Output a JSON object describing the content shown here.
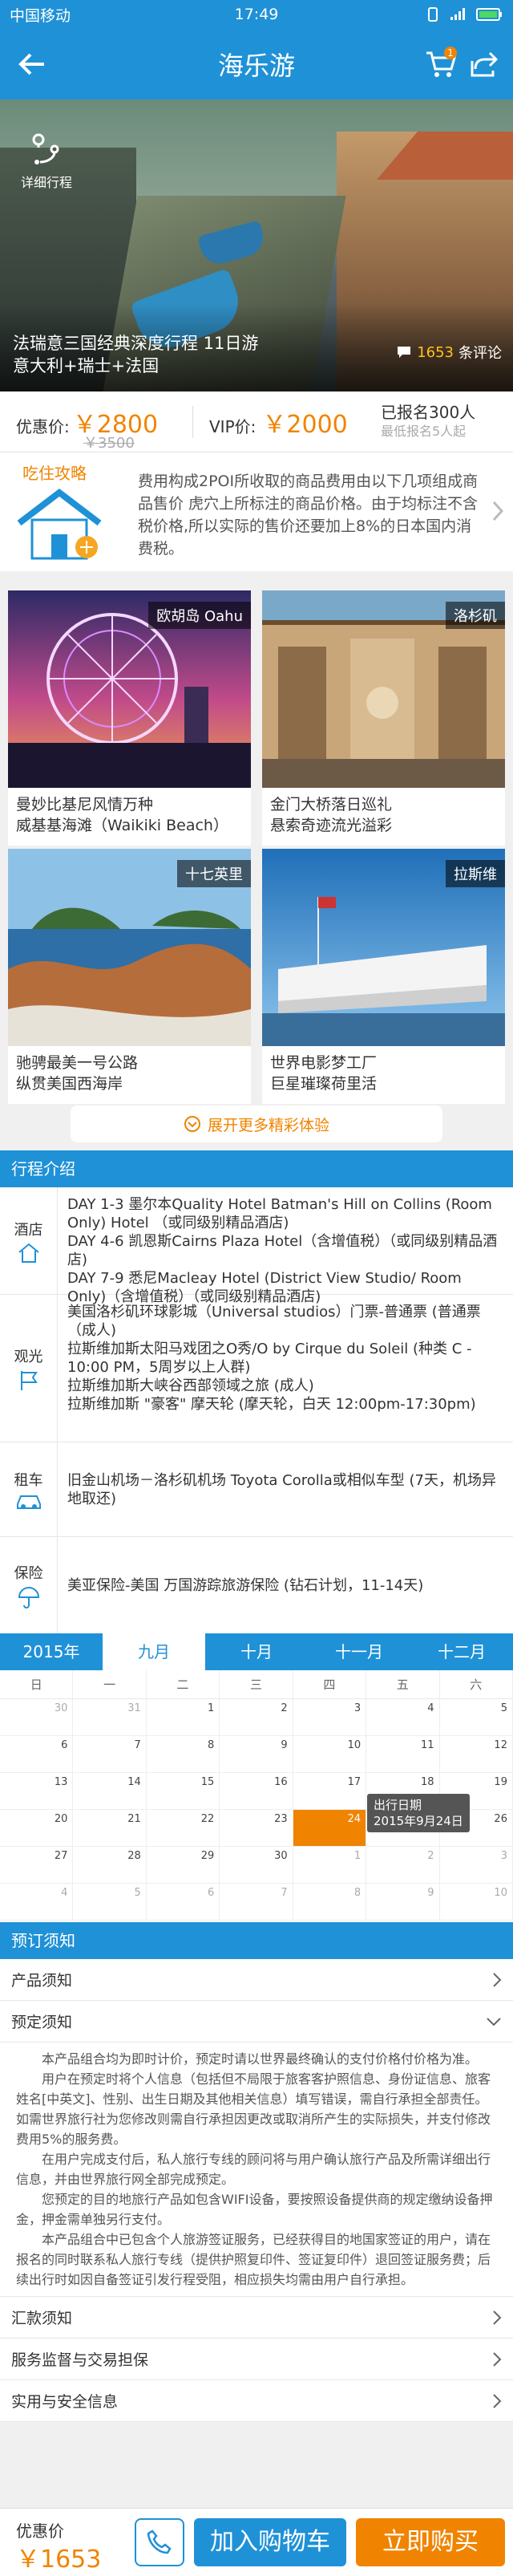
{
  "statusbar": {
    "carrier": "中国移动",
    "time": "17:49"
  },
  "nav": {
    "title": "海乐游",
    "cart_badge": "1"
  },
  "hero": {
    "detail_label": "详细行程",
    "name_line1": "法瑞意三国经典深度行程  11日游",
    "name_line2": "意大利+瑞士+法国",
    "review_count": "1653",
    "review_suffix": "条评论"
  },
  "price": {
    "label": "优惠价:",
    "value": "￥2800",
    "old": "￥3500",
    "vip_label": "VIP价:",
    "vip_value": "￥2000",
    "signed": "已报名300人",
    "min": "最低报名5人起"
  },
  "tips": {
    "title": "吃住攻略",
    "text": "费用构成2POI所收取的商品费用由以下几项组成商品售价 虎穴上所标注的商品价格。由于均标注不含税价格,所以实际的售价还要加上8%的日本国内消费税。"
  },
  "cards": [
    {
      "tag": "欧胡岛 Oahu",
      "cap1": "曼妙比基尼风情万种",
      "cap2": "威基基海滩（Waikiki Beach）"
    },
    {
      "tag": "洛杉矶",
      "cap1": "金门大桥落日巡礼",
      "cap2": "悬索奇迹流光溢彩"
    },
    {
      "tag": "十七英里",
      "cap1": "驰骋最美一号公路",
      "cap2": "纵贯美国西海岸"
    },
    {
      "tag": "拉斯维",
      "cap1": "世界电影梦工厂",
      "cap2": "巨星璀璨荷里活"
    }
  ],
  "more_label": "展开更多精彩体验",
  "itinerary": {
    "title": "行程介绍",
    "hotel_label": "酒店",
    "hotel_text": [
      "DAY 1-3 墨尔本Quality Hotel Batman's Hill on Collins (Room Only) Hotel （或同级别精品酒店)",
      "DAY 4-6 凯恩斯Cairns Plaza Hotel（含增值税）（或同级别精品酒店)",
      "DAY 7-9 悉尼Macleay Hotel (District View Studio/ Room Only)（含增值税）（或同级别精品酒店)"
    ],
    "sight_label": "观光",
    "sight_text": [
      "美国洛杉矶环球影城（Universal studios）门票-普通票 (普通票（成人)",
      "拉斯维加斯太阳马戏团之O秀/O by Cirque du Soleil (种类 C - 10:00 PM，5周岁以上人群)",
      "拉斯维加斯大峡谷西部领域之旅 (成人)",
      "拉斯维加斯 \"豪客\" 摩天轮 (摩天轮，白天 12:00pm-17:30pm)"
    ],
    "car_label": "租车",
    "car_text": "旧金山机场－洛杉矶机场 Toyota Corolla或相似车型 (7天，机场异地取还)",
    "ins_label": "保险",
    "ins_text": "美亚保险-美国 万国游踪旅游保险 (钻石计划，11-14天)"
  },
  "calendar": {
    "months": [
      "2015年",
      "九月",
      "十月",
      "十一月",
      "十二月"
    ],
    "weekdays": [
      "日",
      "一",
      "二",
      "三",
      "四",
      "五",
      "六"
    ],
    "rows": [
      [
        "30",
        "31",
        "1",
        "2",
        "3",
        "4",
        "5"
      ],
      [
        "6",
        "7",
        "8",
        "9",
        "10",
        "11",
        "12"
      ],
      [
        "13",
        "14",
        "15",
        "16",
        "17",
        "18",
        "19"
      ],
      [
        "20",
        "21",
        "22",
        "23",
        "24",
        "25",
        "26"
      ],
      [
        "27",
        "28",
        "29",
        "30",
        "1",
        "2",
        "3"
      ],
      [
        "4",
        "5",
        "6",
        "7",
        "8",
        "9",
        "10"
      ]
    ],
    "tip_line1": "出行日期",
    "tip_line2": "2015年9月24日"
  },
  "notes": {
    "title": "预订须知",
    "items": [
      "产品须知",
      "预定须知",
      "汇款须知",
      "服务监督与交易担保",
      "实用与安全信息"
    ],
    "paras": [
      "本产品组合均为即时计价，预定时请以世界最终确认的支付价格付价格为准。",
      "用户在预定时将个人信息（包括但不局限于旅客客护照信息、身份证信息、旅客姓名[中英文]、性别、出生日期及其他相关信息）填写错误，需自行承担全部责任。如需世界旅行社为您修改则需自行承担因更改或取消所产生的实际损失，并支付修改费用5%的服务费。",
      "在用户完成支付后，私人旅行专线的顾问将与用户确认旅行产品及所需详细出行信息，并由世界旅行网全部完成预定。",
      "您预定的目的地旅行产品如包含WIFI设备，要按照设备提供商的规定缴纳设备押金，押金需单独另行支付。",
      "本产品组合中已包含个人旅游签证服务，已经获得目的地国家签证的用户，请在报名的同时联系私人旅行专线（提供护照复印件、签证复印件）退回签证服务费；后续出行时如因自备签证引发行程受阻，相应损失均需由用户自行承担。"
    ]
  },
  "bottom": {
    "price_label": "优惠价",
    "price_value": "￥1653",
    "add_cart": "加入购物车",
    "buy": "立即购买"
  }
}
